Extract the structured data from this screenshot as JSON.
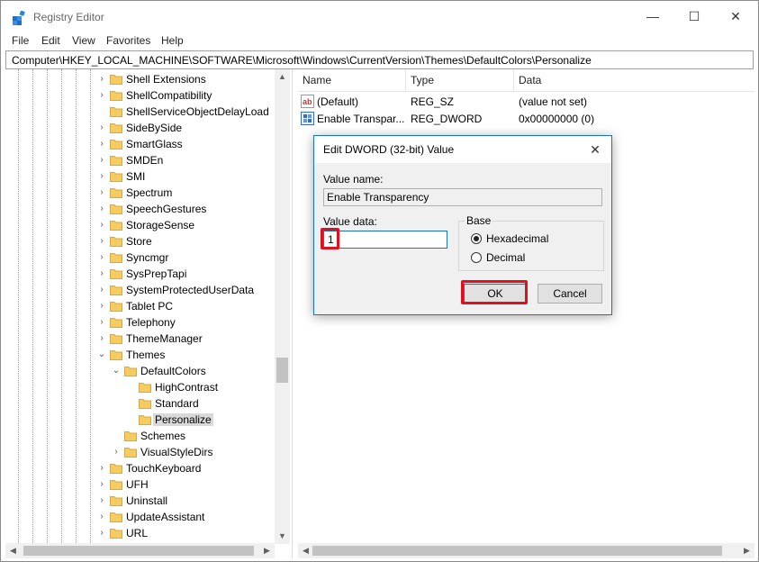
{
  "window": {
    "title": "Registry Editor",
    "minimize_glyph": "—",
    "maximize_glyph": "☐",
    "close_glyph": "✕"
  },
  "menu": [
    "File",
    "Edit",
    "View",
    "Favorites",
    "Help"
  ],
  "address": "Computer\\HKEY_LOCAL_MACHINE\\SOFTWARE\\Microsoft\\Windows\\CurrentVersion\\Themes\\DefaultColors\\Personalize",
  "tree": {
    "items": [
      {
        "label": "Shell Extensions",
        "level": 0,
        "expander": "collapsed"
      },
      {
        "label": "ShellCompatibility",
        "level": 0,
        "expander": "collapsed"
      },
      {
        "label": "ShellServiceObjectDelayLoad",
        "level": 0,
        "expander": "none"
      },
      {
        "label": "SideBySide",
        "level": 0,
        "expander": "collapsed"
      },
      {
        "label": "SmartGlass",
        "level": 0,
        "expander": "collapsed"
      },
      {
        "label": "SMDEn",
        "level": 0,
        "expander": "collapsed"
      },
      {
        "label": "SMI",
        "level": 0,
        "expander": "collapsed"
      },
      {
        "label": "Spectrum",
        "level": 0,
        "expander": "collapsed"
      },
      {
        "label": "SpeechGestures",
        "level": 0,
        "expander": "collapsed"
      },
      {
        "label": "StorageSense",
        "level": 0,
        "expander": "collapsed"
      },
      {
        "label": "Store",
        "level": 0,
        "expander": "collapsed"
      },
      {
        "label": "Syncmgr",
        "level": 0,
        "expander": "collapsed"
      },
      {
        "label": "SysPrepTapi",
        "level": 0,
        "expander": "collapsed"
      },
      {
        "label": "SystemProtectedUserData",
        "level": 0,
        "expander": "collapsed"
      },
      {
        "label": "Tablet PC",
        "level": 0,
        "expander": "collapsed"
      },
      {
        "label": "Telephony",
        "level": 0,
        "expander": "collapsed"
      },
      {
        "label": "ThemeManager",
        "level": 0,
        "expander": "collapsed"
      },
      {
        "label": "Themes",
        "level": 0,
        "expander": "expanded"
      },
      {
        "label": "DefaultColors",
        "level": 1,
        "expander": "expanded"
      },
      {
        "label": "HighContrast",
        "level": 2,
        "expander": "none"
      },
      {
        "label": "Standard",
        "level": 2,
        "expander": "none"
      },
      {
        "label": "Personalize",
        "level": 2,
        "expander": "none",
        "selected": true
      },
      {
        "label": "Schemes",
        "level": 1,
        "expander": "none"
      },
      {
        "label": "VisualStyleDirs",
        "level": 1,
        "expander": "collapsed"
      },
      {
        "label": "TouchKeyboard",
        "level": 0,
        "expander": "collapsed"
      },
      {
        "label": "UFH",
        "level": 0,
        "expander": "collapsed"
      },
      {
        "label": "Uninstall",
        "level": 0,
        "expander": "collapsed"
      },
      {
        "label": "UpdateAssistant",
        "level": 0,
        "expander": "collapsed"
      },
      {
        "label": "URL",
        "level": 0,
        "expander": "collapsed"
      }
    ]
  },
  "list": {
    "columns": [
      "Name",
      "Type",
      "Data"
    ],
    "rows": [
      {
        "icon": "string-value-icon",
        "name": "(Default)",
        "type": "REG_SZ",
        "data": "(value not set)"
      },
      {
        "icon": "dword-value-icon",
        "name": "Enable Transpar...",
        "type": "REG_DWORD",
        "data": "0x00000000 (0)"
      }
    ]
  },
  "dialog": {
    "title": "Edit DWORD (32-bit) Value",
    "value_name_label": "Value name:",
    "value_name": "Enable Transparency",
    "value_data_label": "Value data:",
    "value_data": "1",
    "base_label": "Base",
    "radio_hex": "Hexadecimal",
    "radio_dec": "Decimal",
    "selected_base": "Hexadecimal",
    "ok_label": "OK",
    "cancel_label": "Cancel"
  },
  "colors": {
    "highlight": "#e0101f",
    "accent": "#1a73c2",
    "folder": "#f5cc62"
  }
}
